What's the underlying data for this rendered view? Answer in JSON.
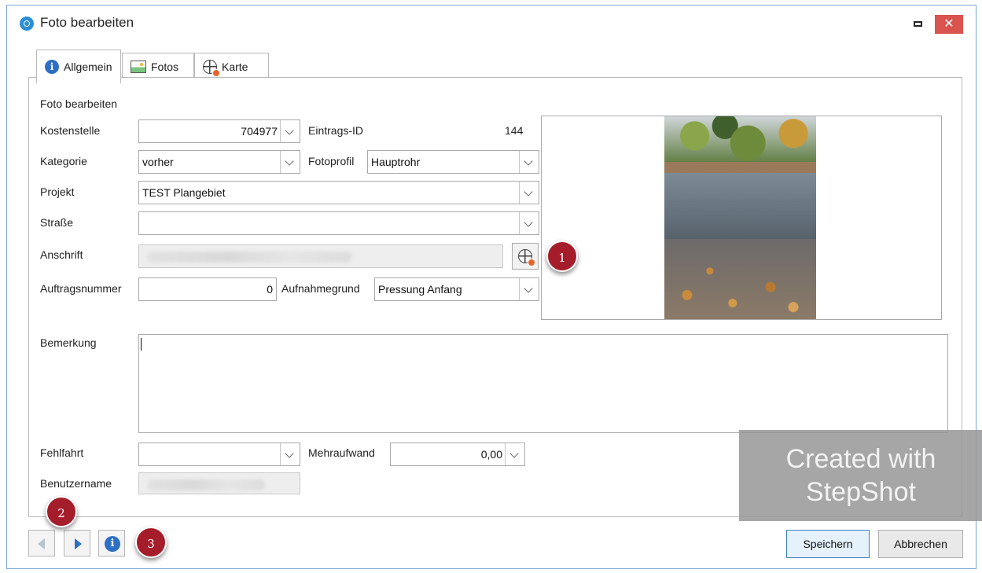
{
  "window": {
    "title": "Foto bearbeiten",
    "close_glyph": "✕"
  },
  "tabs": [
    {
      "label": "Allgemein",
      "icon": "info-icon",
      "active": true
    },
    {
      "label": "Fotos",
      "icon": "photo-icon",
      "active": false
    },
    {
      "label": "Karte",
      "icon": "globe-pin-icon",
      "active": false
    }
  ],
  "form": {
    "section_title": "Foto bearbeiten",
    "kostenstelle": {
      "label": "Kostenstelle",
      "value": "704977"
    },
    "eintrags_id": {
      "label": "Eintrags-ID",
      "value": "144"
    },
    "kategorie": {
      "label": "Kategorie",
      "value": "vorher"
    },
    "fotoprofil": {
      "label": "Fotoprofil",
      "value": "Hauptrohr"
    },
    "projekt": {
      "label": "Projekt",
      "value": "TEST Plangebiet"
    },
    "strasse": {
      "label": "Straße",
      "value": ""
    },
    "anschrift": {
      "label": "Anschrift"
    },
    "auftragsnummer": {
      "label": "Auftragsnummer",
      "value": "0"
    },
    "aufnahmegrund": {
      "label": "Aufnahmegrund",
      "value": "Pressung Anfang"
    },
    "bemerkung": {
      "label": "Bemerkung",
      "value": ""
    },
    "fehlfahrt": {
      "label": "Fehlfahrt",
      "value": ""
    },
    "mehraufwand": {
      "label": "Mehraufwand",
      "value": "0,00"
    },
    "benutzername": {
      "label": "Benutzername"
    }
  },
  "badges": {
    "one": "1",
    "two": "2",
    "three": "3"
  },
  "info_glyph": "i",
  "watermark": {
    "line1": "Created with",
    "line2": "StepShot"
  },
  "buttons": {
    "save": "Speichern",
    "cancel": "Abbrechen"
  },
  "colors": {
    "accent": "#2d6fc4",
    "badge": "#a51c2b",
    "close": "#d9534f"
  }
}
